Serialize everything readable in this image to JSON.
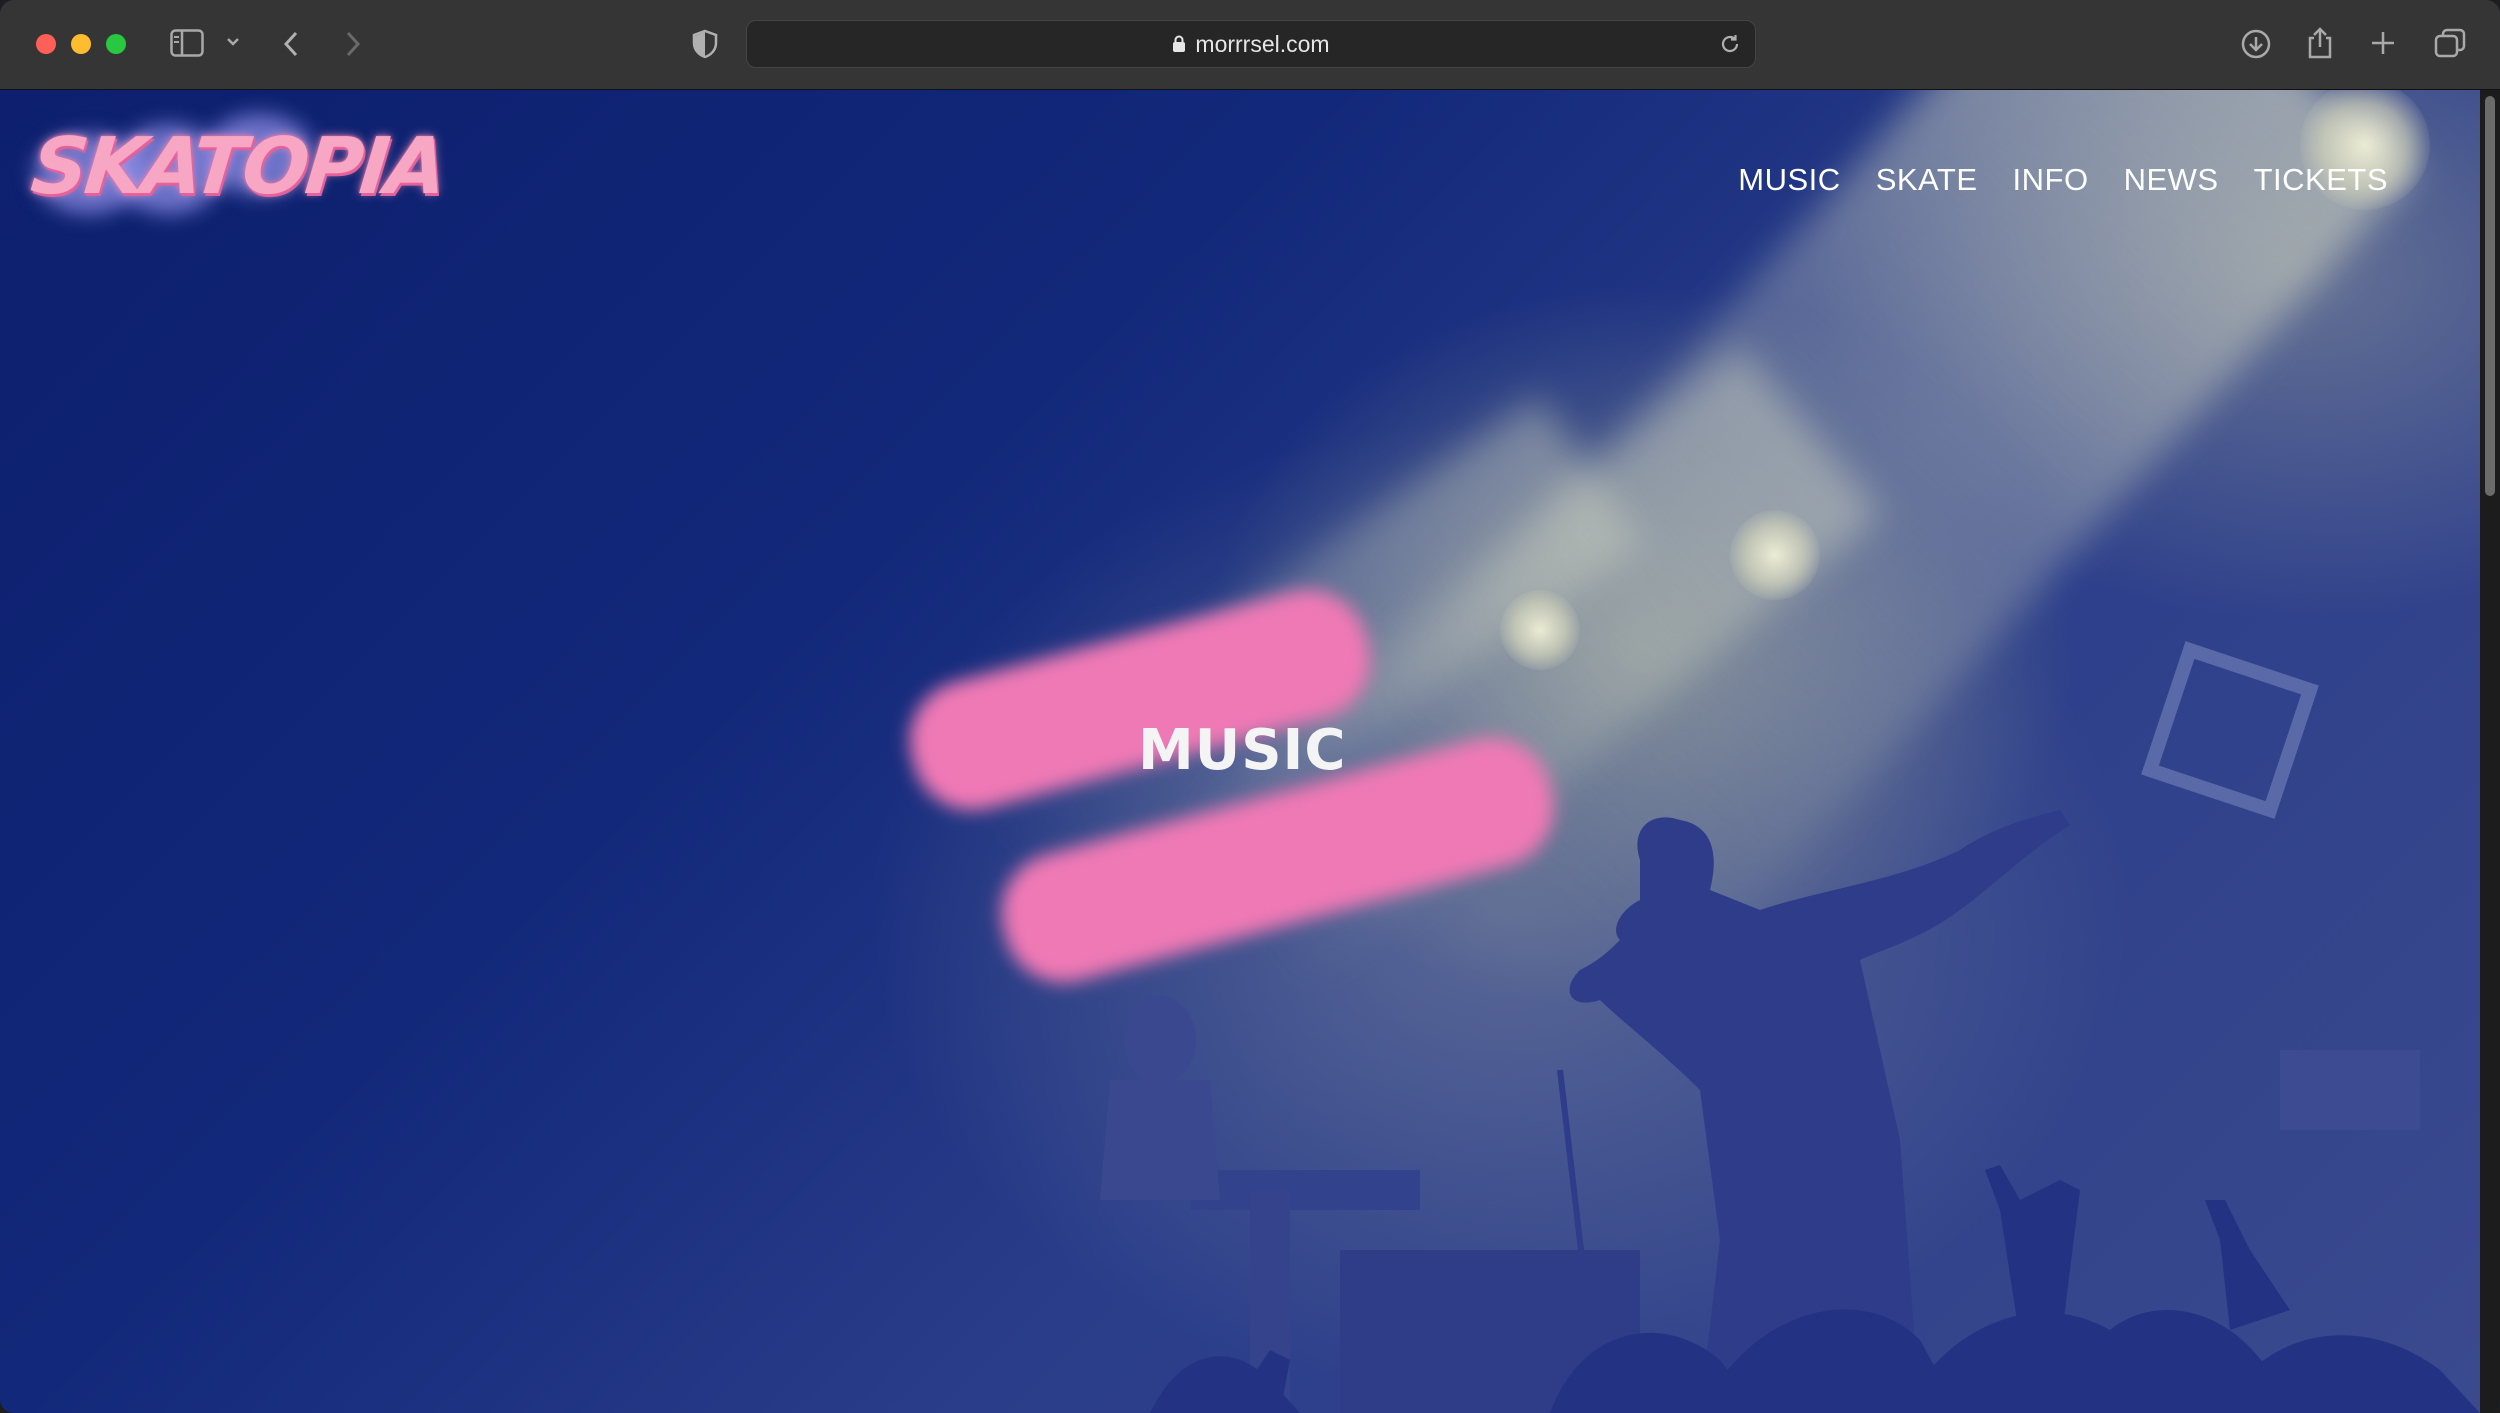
{
  "browser": {
    "url": "morrrsel.com",
    "icons": {
      "sidebar": "sidebar-icon",
      "tab_group": "chevron-down-icon",
      "back": "chevron-left-icon",
      "forward": "chevron-right-icon",
      "privacy": "shield-icon",
      "lock": "lock-icon",
      "reload": "reload-icon",
      "downloads": "download-icon",
      "share": "share-icon",
      "new_tab": "plus-icon",
      "tab_overview": "tabs-icon"
    }
  },
  "site": {
    "logo_text": "SKATOPIA",
    "nav": [
      {
        "label": "MUSIC"
      },
      {
        "label": "SKATE"
      },
      {
        "label": "INFO"
      },
      {
        "label": "NEWS"
      },
      {
        "label": "TICKETS"
      }
    ],
    "hero": {
      "title": "MUSIC"
    }
  },
  "colors": {
    "accent_pink": "#ef79b5",
    "background_blue": "#12287a"
  }
}
